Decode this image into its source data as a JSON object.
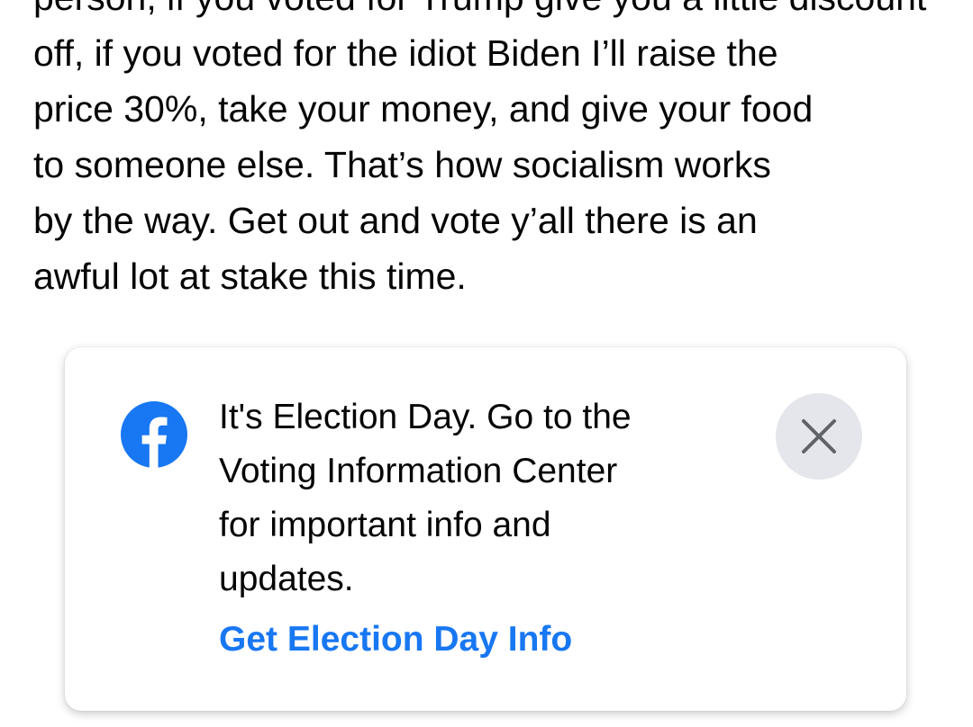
{
  "post": {
    "lines": [
      "person, if you voted for Trump give you a little discount",
      "off, if you voted for the idiot Biden I’ll raise the",
      "price 30%, take your money, and give your food",
      "to someone else. That’s how socialism works",
      "by the way. Get out and vote y’all there is an",
      "awful lot at stake this time."
    ]
  },
  "notice": {
    "message": "It's Election Day. Go to the Voting Information Center for important info and updates.",
    "message_lines": [
      "It's Election Day. Go to the",
      "Voting Information Center",
      "for important info and",
      "updates."
    ],
    "link_label": "Get Election Day Info",
    "logo_icon": "facebook-logo-icon",
    "close_icon": "close-icon"
  },
  "colors": {
    "text": "#050505",
    "link": "#1877f2",
    "facebook_blue": "#1877f2",
    "close_bg": "#e4e6eb",
    "close_icon": "#606770"
  }
}
